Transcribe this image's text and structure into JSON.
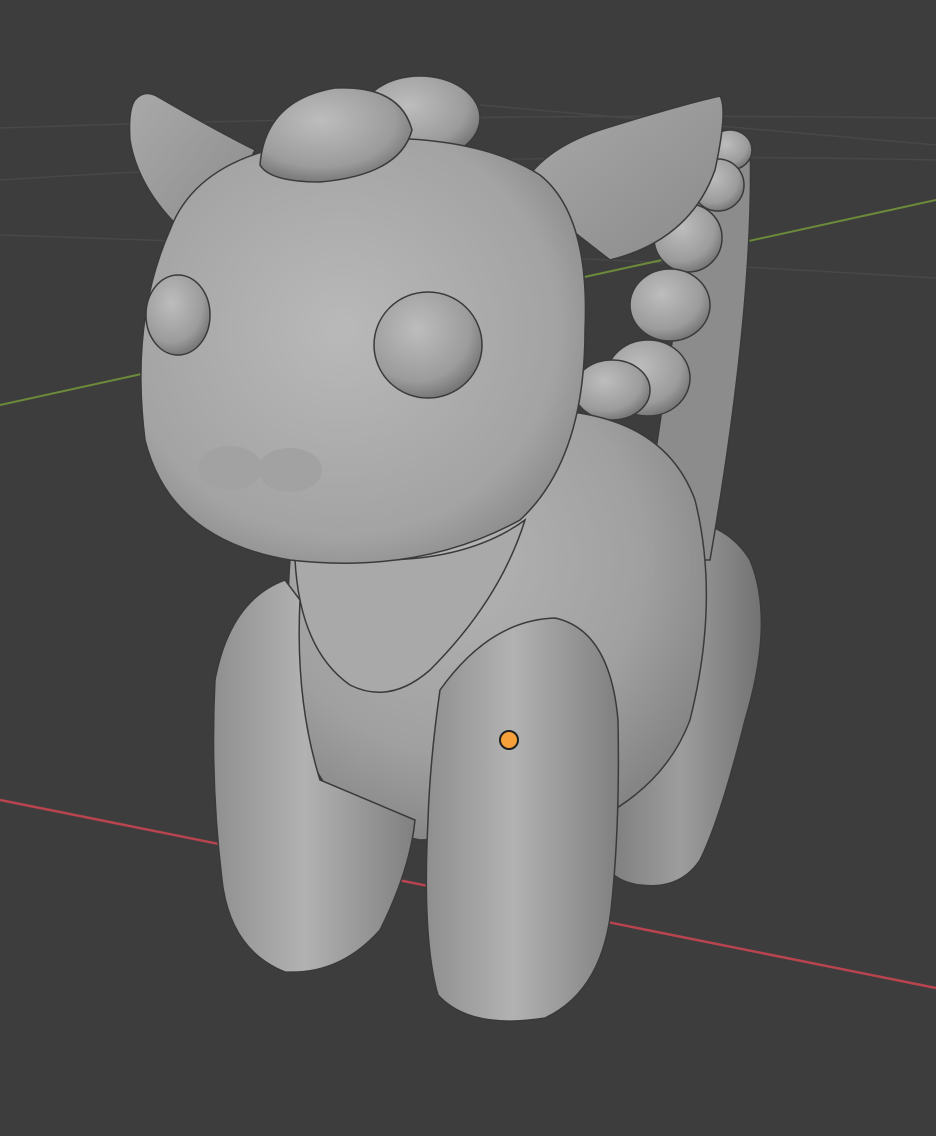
{
  "app": {
    "view": "3d-viewport",
    "shading_mode": "solid"
  },
  "scene": {
    "object_name_hint": "baby-dragon-model",
    "object_parts": [
      "head",
      "horn-left",
      "horn-right",
      "eye-left",
      "eye-right",
      "snout",
      "crest",
      "body",
      "tail-spikes",
      "front-leg-left",
      "front-leg-right",
      "back-leg-right"
    ],
    "origin_marker": {
      "type": "object-origin",
      "color": "#f5a03a"
    },
    "axes": {
      "x": {
        "color": "#b7444f",
        "label": "X axis"
      },
      "y": {
        "color": "#6b8a3a",
        "label": "Y axis"
      }
    },
    "background_color": "#3d3d3d",
    "grid_color": "#4a4a4a",
    "material_color": "#a7a7a7"
  }
}
